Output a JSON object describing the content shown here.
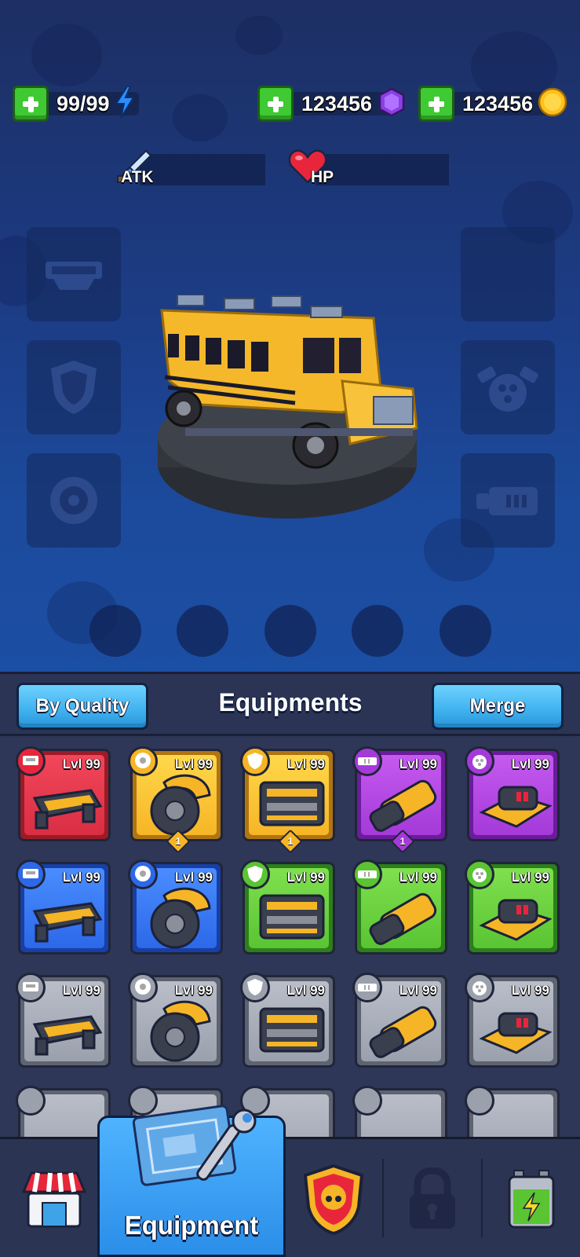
{
  "resources": {
    "energy": {
      "value": "99/99",
      "icon": "lightning-icon",
      "color": "#2b8cff"
    },
    "gems": {
      "value": "123456",
      "icon": "gem-icon",
      "color": "#8b3fe6"
    },
    "coins": {
      "value": "123456",
      "icon": "coin-icon",
      "color": "#ffc21a"
    }
  },
  "stats": {
    "atk": {
      "label": "ATK",
      "icon": "sword-icon"
    },
    "hp": {
      "label": "HP",
      "icon": "heart-icon"
    }
  },
  "vehicle": {
    "name": "school-bus"
  },
  "equipment_slots": {
    "left": [
      {
        "name": "slot-bumper",
        "icon": "bumper-icon"
      },
      {
        "name": "slot-armor",
        "icon": "shield-icon"
      },
      {
        "name": "slot-wheel",
        "icon": "wheel-icon"
      }
    ],
    "right": [
      {
        "name": "slot-roof",
        "icon": "empty"
      },
      {
        "name": "slot-engine",
        "icon": "engine-icon"
      },
      {
        "name": "slot-weapon",
        "icon": "cannon-icon"
      }
    ]
  },
  "tabbar": {
    "sort_label": "By Quality",
    "title": "Equipments",
    "merge_label": "Merge"
  },
  "inventory": [
    {
      "quality": "red",
      "type": "bumper",
      "level": "Lvl 99"
    },
    {
      "quality": "gold",
      "type": "wheel",
      "level": "Lvl 99",
      "count": "1"
    },
    {
      "quality": "gold",
      "type": "armor",
      "level": "Lvl 99",
      "count": "1"
    },
    {
      "quality": "purple",
      "type": "weapon",
      "level": "Lvl 99",
      "count": "1"
    },
    {
      "quality": "purple",
      "type": "engine",
      "level": "Lvl 99"
    },
    {
      "quality": "blue",
      "type": "bumper",
      "level": "Lvl 99"
    },
    {
      "quality": "blue",
      "type": "wheel",
      "level": "Lvl 99"
    },
    {
      "quality": "green",
      "type": "armor",
      "level": "Lvl 99"
    },
    {
      "quality": "green",
      "type": "weapon",
      "level": "Lvl 99"
    },
    {
      "quality": "green",
      "type": "engine",
      "level": "Lvl 99"
    },
    {
      "quality": "gray",
      "type": "bumper",
      "level": "Lvl 99"
    },
    {
      "quality": "gray",
      "type": "wheel",
      "level": "Lvl 99"
    },
    {
      "quality": "gray",
      "type": "armor",
      "level": "Lvl 99"
    },
    {
      "quality": "gray",
      "type": "weapon",
      "level": "Lvl 99"
    },
    {
      "quality": "gray",
      "type": "engine",
      "level": "Lvl 99"
    }
  ],
  "bottom_nav": {
    "shop": {
      "icon": "shop-icon"
    },
    "equipment": {
      "label": "Equipment",
      "icon": "blueprint-wrench-icon"
    },
    "skull_badge": {
      "icon": "skull-badge-icon"
    },
    "locked": {
      "icon": "lock-icon"
    },
    "battery": {
      "icon": "battery-icon"
    }
  }
}
